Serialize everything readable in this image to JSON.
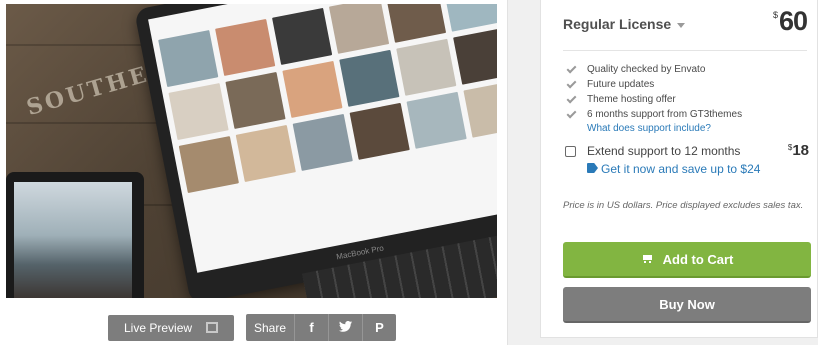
{
  "preview": {
    "sign_text": "SOUTHERN",
    "laptop_label": "MacBook Pro",
    "live_preview_label": "Live Preview",
    "share_label": "Share",
    "share_buttons": [
      {
        "name": "facebook",
        "glyph": "f"
      },
      {
        "name": "twitter",
        "glyph": "❖"
      },
      {
        "name": "pinterest",
        "glyph": "P"
      }
    ]
  },
  "license": {
    "name": "Regular License",
    "currency": "$",
    "price": "60"
  },
  "features": [
    "Quality checked by Envato",
    "Future updates",
    "Theme hosting offer",
    "6 months support from GT3themes"
  ],
  "support_link": "What does support include?",
  "extend": {
    "label": "Extend support to 12 months",
    "currency": "$",
    "price": "18",
    "save_text": "Get it now and save up to $24",
    "checked": false
  },
  "note": "Price is in US dollars. Price displayed excludes sales tax.",
  "buttons": {
    "add_to_cart": "Add to Cart",
    "buy_now": "Buy Now"
  },
  "colors": {
    "add_to_cart": "#82b541",
    "buy_now": "#7d7d7d",
    "link": "#2a7ab8"
  }
}
